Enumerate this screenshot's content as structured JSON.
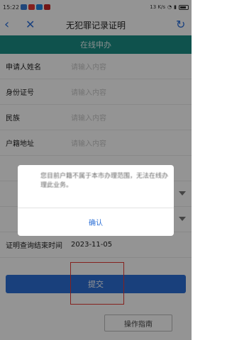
{
  "status_bar": {
    "time": "15:22",
    "network": "13 K/s",
    "battery": "68"
  },
  "header": {
    "title": "无犯罪记录证明"
  },
  "section": {
    "title": "在线申办"
  },
  "form": {
    "rows": [
      {
        "label": "申请人姓名",
        "value": "请输入内容"
      },
      {
        "label": "身份证号",
        "value": "请输入内容"
      },
      {
        "label": "民族",
        "value": "请输入内容"
      },
      {
        "label": "户籍地址",
        "value": "请输入内容"
      },
      {
        "label": "",
        "value": ""
      },
      {
        "label": "",
        "value": ""
      },
      {
        "label": "",
        "value": ""
      },
      {
        "label": "证明查询结束时间",
        "value": "2023-11-05"
      }
    ]
  },
  "dialog": {
    "message": "您目前户籍不属于本市办理范围，无法在线办理此业务。",
    "ok_label": "确认"
  },
  "actions": {
    "submit_label": "提交",
    "guide_label": "操作指南"
  },
  "colors": {
    "accent": "#2b6fd6",
    "header_band": "#1b8e86",
    "highlight": "#e53935"
  }
}
